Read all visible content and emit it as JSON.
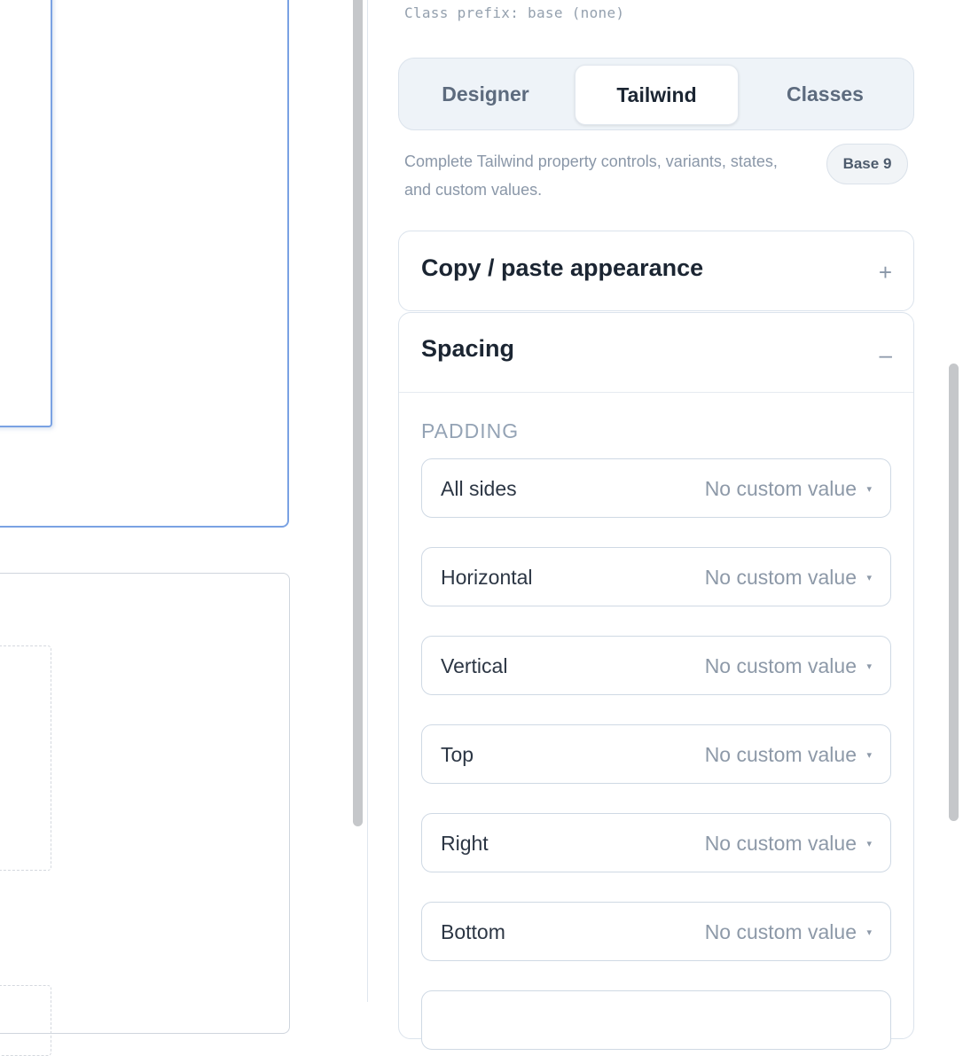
{
  "panel": {
    "class_prefix": "Class prefix: base (none)",
    "tabs": [
      {
        "label": "Designer",
        "active": false
      },
      {
        "label": "Tailwind",
        "active": true
      },
      {
        "label": "Classes",
        "active": false
      }
    ],
    "description": "Complete Tailwind property controls, variants, states, and custom values.",
    "badge": "Base 9",
    "sections": {
      "copy_paste": {
        "title": "Copy / paste appearance",
        "toggle": "+"
      },
      "spacing": {
        "title": "Spacing",
        "toggle": "–",
        "group_label": "PADDING",
        "fields": [
          {
            "label": "All sides",
            "value": "No custom value",
            "caret": "▾"
          },
          {
            "label": "Horizontal",
            "value": "No custom value",
            "caret": "▾"
          },
          {
            "label": "Vertical",
            "value": "No custom value",
            "caret": "▾"
          },
          {
            "label": "Top",
            "value": "No custom value",
            "caret": "▾"
          },
          {
            "label": "Right",
            "value": "No custom value",
            "caret": "▾"
          },
          {
            "label": "Bottom",
            "value": "No custom value",
            "caret": "▾"
          },
          {
            "label": "",
            "value": "",
            "caret": ""
          }
        ]
      }
    }
  },
  "colors": {
    "selection_outline": "#7aa2e3",
    "active_tab_bg": "#ffffff",
    "tabs_bg": "#eef3f8",
    "text_dark": "#1b2532",
    "text_muted": "#8d99a8"
  }
}
